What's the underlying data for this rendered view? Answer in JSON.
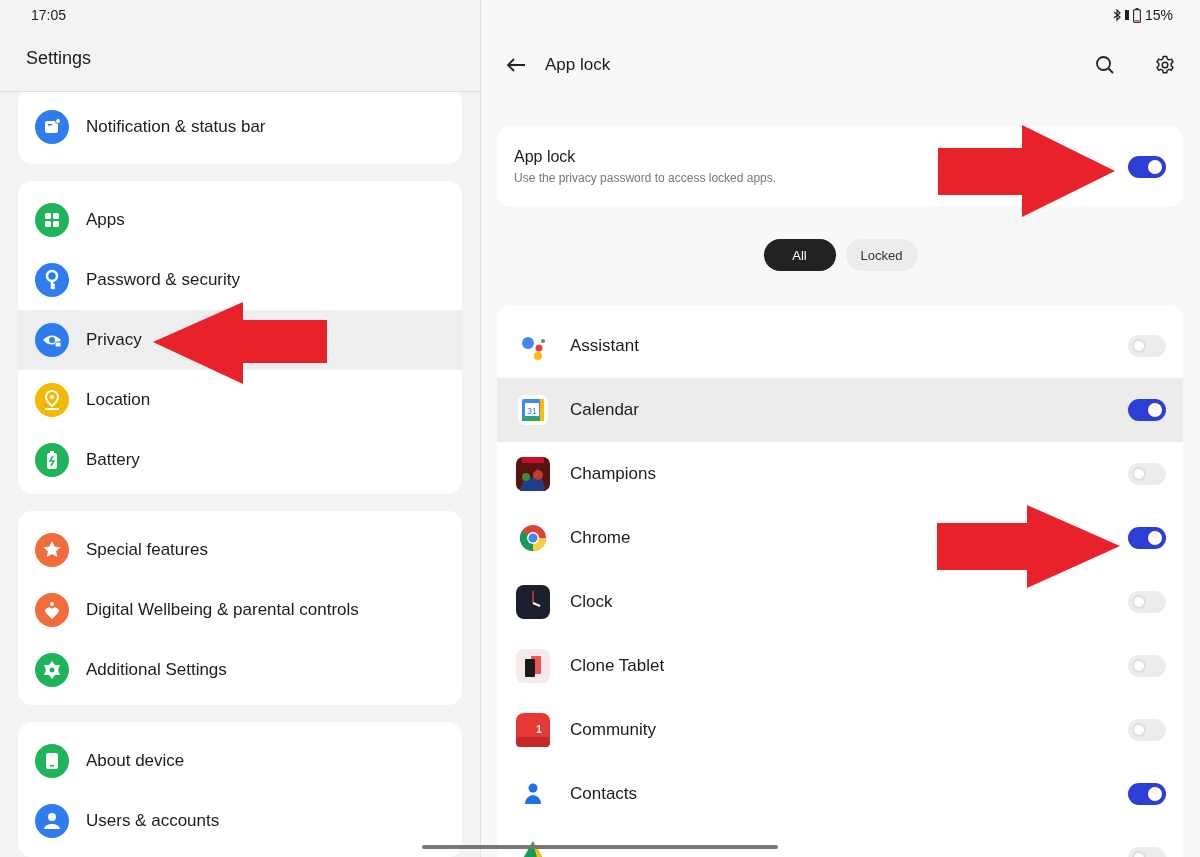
{
  "status_bar": {
    "time": "17:05",
    "battery": "15%"
  },
  "settings": {
    "title": "Settings",
    "groups": [
      {
        "items": [
          {
            "label": "Notification & status bar",
            "kind": "notification",
            "selected": false
          }
        ]
      },
      {
        "items": [
          {
            "label": "Apps",
            "kind": "apps",
            "selected": false
          },
          {
            "label": "Password & security",
            "kind": "key",
            "selected": false
          },
          {
            "label": "Privacy",
            "kind": "eye",
            "selected": true
          },
          {
            "label": "Location",
            "kind": "pin",
            "selected": false
          },
          {
            "label": "Battery",
            "kind": "battery",
            "selected": false
          }
        ]
      },
      {
        "items": [
          {
            "label": "Special features",
            "kind": "star",
            "selected": false
          },
          {
            "label": "Digital Wellbeing & parental controls",
            "kind": "heart",
            "selected": false
          },
          {
            "label": "Additional Settings",
            "kind": "cog",
            "selected": false
          }
        ]
      },
      {
        "items": [
          {
            "label": "About device",
            "kind": "phone",
            "selected": false
          },
          {
            "label": "Users & accounts",
            "kind": "person",
            "selected": false
          }
        ]
      }
    ]
  },
  "app_lock": {
    "title": "App lock",
    "switch": {
      "label": "App lock",
      "description": "Use the privacy password to access locked apps.",
      "on": true
    },
    "filters": [
      {
        "label": "All",
        "selected": true
      },
      {
        "label": "Locked",
        "selected": false
      }
    ],
    "apps": [
      {
        "name": "Assistant",
        "kind": "assistant",
        "locked": false,
        "highlighted": false
      },
      {
        "name": "Calendar",
        "kind": "calendar",
        "icon_text": "31",
        "locked": true,
        "highlighted": true
      },
      {
        "name": "Champions",
        "kind": "game",
        "locked": false,
        "highlighted": false
      },
      {
        "name": "Chrome",
        "kind": "chrome",
        "locked": true,
        "highlighted": false
      },
      {
        "name": "Clock",
        "kind": "clock",
        "locked": false,
        "highlighted": false
      },
      {
        "name": "Clone Tablet",
        "kind": "clone",
        "locked": false,
        "highlighted": false
      },
      {
        "name": "Community",
        "kind": "community",
        "icon_text": "1",
        "locked": false,
        "highlighted": false
      },
      {
        "name": "Contacts",
        "kind": "contacts",
        "locked": true,
        "highlighted": false
      },
      {
        "kind": "drive",
        "locked": false,
        "highlighted": false
      }
    ]
  }
}
